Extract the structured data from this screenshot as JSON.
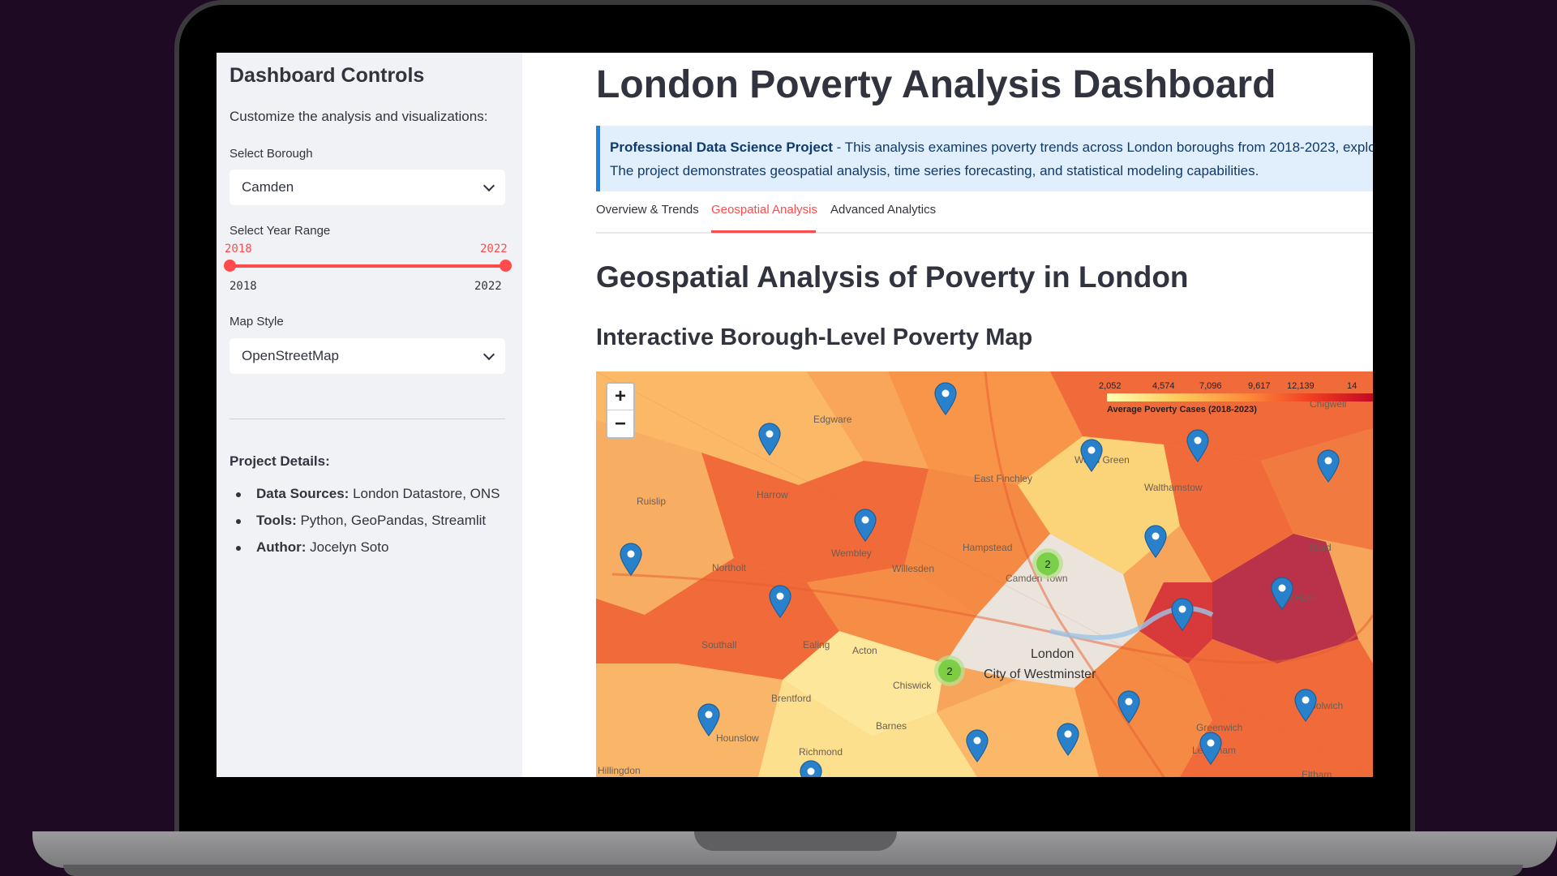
{
  "sidebar": {
    "title": "Dashboard Controls",
    "subtitle": "Customize the analysis and visualizations:",
    "borough_label": "Select Borough",
    "borough_value": "Camden",
    "year_label": "Select Year Range",
    "year_low": "2018",
    "year_high": "2022",
    "year_min": "2018",
    "year_max": "2022",
    "map_style_label": "Map Style",
    "map_style_value": "OpenStreetMap",
    "details_title": "Project Details:",
    "details": [
      {
        "key": "Data Sources:",
        "value": "London Datastore, ONS"
      },
      {
        "key": "Tools:",
        "value": "Python, GeoPandas, Streamlit"
      },
      {
        "key": "Author:",
        "value": "Jocelyn Soto"
      }
    ]
  },
  "main": {
    "title": "London Poverty Analysis Dashboard",
    "info_bold": "Professional Data Science Project",
    "info_text1": " - This analysis examines poverty trends across London boroughs from 2018-2023, explorin",
    "info_text2": "The project demonstrates geospatial analysis, time series forecasting, and statistical modeling capabilities.",
    "tabs": [
      {
        "label": "Overview & Trends"
      },
      {
        "label": "Geospatial Analysis"
      },
      {
        "label": "Advanced Analytics"
      }
    ],
    "section_title": "Geospatial Analysis of Poverty in London",
    "map_title": "Interactive Borough-Level Poverty Map"
  },
  "map": {
    "zoom_in": "+",
    "zoom_out": "−",
    "legend_ticks": [
      "2,052",
      "4,574",
      "7,096",
      "9,617",
      "12,139",
      "14"
    ],
    "legend_title": "Average Poverty Cases (2018-2023)",
    "clusters": [
      "2",
      "2"
    ],
    "labels": [
      "Edgware",
      "Harrow",
      "Ruislip",
      "Wembley",
      "Willesden",
      "Northolt",
      "Southall",
      "Ealing",
      "Acton",
      "Hampstead",
      "East Finchley",
      "Walthamstow",
      "Ilford",
      "London",
      "City of Westminster",
      "Chiswick",
      "Brentford",
      "Hounslow",
      "Barnes",
      "Richmond",
      "Greenwich",
      "Chigwell",
      "Wood Green",
      "East Ham",
      "Woolwich",
      "Lewisham",
      "Eltham",
      "Camden Town",
      "Hillingdon"
    ],
    "colors": {
      "light": "#ffffb2",
      "mid": "#fecc5c",
      "orange": "#fd8d3c",
      "red": "#f03b20",
      "dark": "#bd0026",
      "marker": "#2a81cb"
    }
  }
}
